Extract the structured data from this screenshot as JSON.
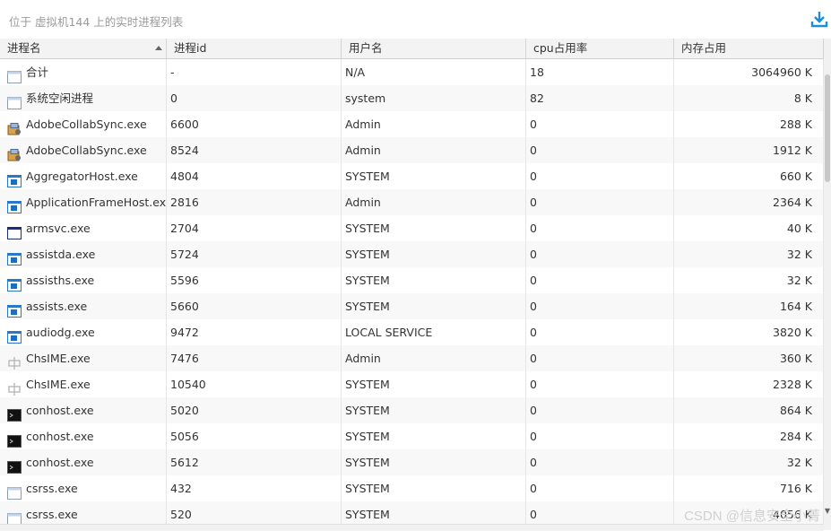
{
  "header": {
    "title": "位于 虚拟机144 上的实时进程列表",
    "download_icon": "download-icon"
  },
  "table": {
    "columns": [
      "进程名",
      "进程id",
      "用户名",
      "cpu占用率",
      "内存占用"
    ],
    "rows": [
      {
        "icon": "window-icon",
        "name": "合计",
        "pid": "-",
        "user": "N/A",
        "cpu": "18",
        "mem": "3064960 K"
      },
      {
        "icon": "window-icon",
        "name": "系统空闲进程",
        "pid": "0",
        "user": "system",
        "cpu": "82",
        "mem": "8 K"
      },
      {
        "icon": "installer-icon",
        "name": "AdobeCollabSync.exe",
        "pid": "6600",
        "user": "Admin",
        "cpu": "0",
        "mem": "288 K"
      },
      {
        "icon": "installer-icon",
        "name": "AdobeCollabSync.exe",
        "pid": "8524",
        "user": "Admin",
        "cpu": "0",
        "mem": "1912 K"
      },
      {
        "icon": "app-icon",
        "name": "AggregatorHost.exe",
        "pid": "4804",
        "user": "SYSTEM",
        "cpu": "0",
        "mem": "660 K"
      },
      {
        "icon": "app-icon",
        "name": "ApplicationFrameHost.exe",
        "pid": "2816",
        "user": "Admin",
        "cpu": "0",
        "mem": "2364 K"
      },
      {
        "icon": "frame-icon",
        "name": "armsvc.exe",
        "pid": "2704",
        "user": "SYSTEM",
        "cpu": "0",
        "mem": "40 K"
      },
      {
        "icon": "app-icon",
        "name": "assistda.exe",
        "pid": "5724",
        "user": "SYSTEM",
        "cpu": "0",
        "mem": "32 K"
      },
      {
        "icon": "app-icon",
        "name": "assisths.exe",
        "pid": "5596",
        "user": "SYSTEM",
        "cpu": "0",
        "mem": "32 K"
      },
      {
        "icon": "app-icon",
        "name": "assists.exe",
        "pid": "5660",
        "user": "SYSTEM",
        "cpu": "0",
        "mem": "164 K"
      },
      {
        "icon": "app-icon",
        "name": "audiodg.exe",
        "pid": "9472",
        "user": "LOCAL SERVICE",
        "cpu": "0",
        "mem": "3820 K"
      },
      {
        "icon": "ime-icon",
        "name": "ChsIME.exe",
        "pid": "7476",
        "user": "Admin",
        "cpu": "0",
        "mem": "360 K"
      },
      {
        "icon": "ime-icon",
        "name": "ChsIME.exe",
        "pid": "10540",
        "user": "SYSTEM",
        "cpu": "0",
        "mem": "2328 K"
      },
      {
        "icon": "console-icon",
        "name": "conhost.exe",
        "pid": "5020",
        "user": "SYSTEM",
        "cpu": "0",
        "mem": "864 K"
      },
      {
        "icon": "console-icon",
        "name": "conhost.exe",
        "pid": "5056",
        "user": "SYSTEM",
        "cpu": "0",
        "mem": "284 K"
      },
      {
        "icon": "console-icon",
        "name": "conhost.exe",
        "pid": "5612",
        "user": "SYSTEM",
        "cpu": "0",
        "mem": "32 K"
      },
      {
        "icon": "window-icon",
        "name": "csrss.exe",
        "pid": "432",
        "user": "SYSTEM",
        "cpu": "0",
        "mem": "716 K"
      },
      {
        "icon": "window-icon",
        "name": "csrss.exe",
        "pid": "520",
        "user": "SYSTEM",
        "cpu": "0",
        "mem": "4056 K"
      }
    ]
  },
  "watermark": "CSDN @信息安全小菁",
  "colors": {
    "accent": "#1a8fd8",
    "header_bg": "#f3f3f3",
    "alt_row": "#f8f8f8"
  }
}
